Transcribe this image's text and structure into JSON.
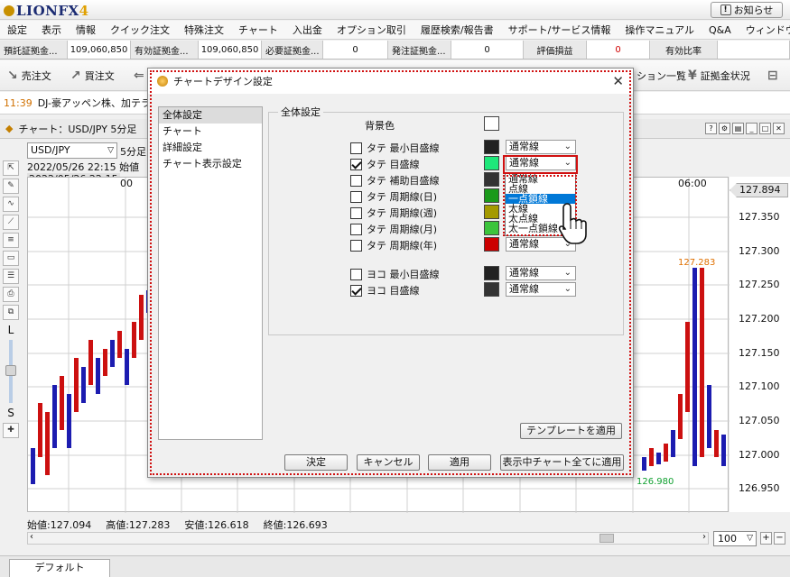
{
  "app": {
    "logo_text": "LIONFX",
    "logo_num": "4",
    "notice_label": "お知らせ"
  },
  "menu": [
    "設定",
    "表示",
    "情報",
    "クイック注文",
    "特殊注文",
    "チャート",
    "入出金",
    "オプション取引",
    "履歴検索/報告書",
    "サポート/サービス情報",
    "操作マニュアル",
    "Q&A",
    "ウィンドウ"
  ],
  "account": [
    {
      "label": "預託証拠金...",
      "value": "109,060,850"
    },
    {
      "label": "有効証拠金...",
      "value": "109,060,850"
    },
    {
      "label": "必要証拠金...",
      "value": "0"
    },
    {
      "label": "発注証拠金...",
      "value": "0"
    },
    {
      "label": "評価損益",
      "value": "0"
    },
    {
      "label": "有効比率",
      "value": ""
    }
  ],
  "toolbar": {
    "sell": "売注文",
    "buy": "買注文",
    "positions": "ション一覧",
    "margin": "証拠金状況"
  },
  "news": {
    "time": "11:39",
    "text": "DJ-豪アッペン株、加テラ"
  },
  "chart": {
    "window_title": "チャート：USD/JPY 5分足",
    "symbol": "USD/JPY",
    "period": "5分足",
    "datetime": "2022/05/26 22:15",
    "open_prefix": "始値",
    "datetime_hl": "2022/05/26 22:15",
    "time_label_1": "00",
    "time_label_2": "06:00",
    "current_price": "127.894",
    "y_ticks": [
      "127.350",
      "127.300",
      "127.250",
      "127.200",
      "127.150",
      "127.100",
      "127.050",
      "127.000",
      "126.950"
    ],
    "high_mark": "127.283",
    "low_mark": "126.980",
    "ohlc": {
      "open": "始値:127.094",
      "high": "高値:127.283",
      "low": "安値:126.618",
      "close": "終値:126.693"
    },
    "zoom": "100",
    "tab": "デフォルト",
    "side_l": "L",
    "side_s": "S"
  },
  "dialog": {
    "title": "チャートデザイン設定",
    "nav": [
      "全体設定",
      "チャート",
      "詳細設定",
      "チャート表示設定"
    ],
    "group_title": "全体設定",
    "bg_label": "背景色",
    "rows": [
      {
        "label": "タテ 最小目盛線",
        "checked": false,
        "color": "#222222",
        "style": "通常線"
      },
      {
        "label": "タテ 目盛線",
        "checked": true,
        "color": "#1ee87a",
        "style": "通常線"
      },
      {
        "label": "タテ 補助目盛線",
        "checked": false,
        "color": "#333333",
        "style": ""
      },
      {
        "label": "タテ 周期線(日)",
        "checked": false,
        "color": "#1a9a1a",
        "style": ""
      },
      {
        "label": "タテ 周期線(週)",
        "checked": false,
        "color": "#a49a00",
        "style": ""
      },
      {
        "label": "タテ 周期線(月)",
        "checked": false,
        "color": "#3cc43c",
        "style": ""
      },
      {
        "label": "タテ 周期線(年)",
        "checked": false,
        "color": "#cc0000",
        "style": "通常線"
      },
      {
        "label": "ヨコ 最小目盛線",
        "checked": false,
        "color": "#222222",
        "style": "通常線"
      },
      {
        "label": "ヨコ 目盛線",
        "checked": true,
        "color": "#333333",
        "style": "通常線"
      }
    ],
    "dropdown_options": [
      "通常線",
      "点線",
      "一点鎖線",
      "太線",
      "太点線",
      "太一点鎖線"
    ],
    "dropdown_highlight": "一点鎖線",
    "template_btn": "テンプレートを適用",
    "ok_btn": "決定",
    "cancel_btn": "キャンセル",
    "apply_btn": "適用",
    "apply_all_btn": "表示中チャート全てに適用"
  },
  "colors": {
    "bull": "#1c1cb0",
    "bear": "#cc1010",
    "accent_red": "#d01010",
    "highlight_blue": "#0078d7"
  }
}
